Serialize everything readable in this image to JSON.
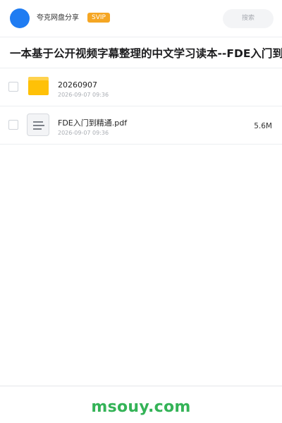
{
  "header": {
    "user_name": "夸克网盘分享",
    "badge": "SVIP",
    "search_placeholder": "搜索"
  },
  "folder": {
    "title": "一本基于公开视频字幕整理的中文学习读本--FDE入门到精通"
  },
  "files": [
    {
      "type": "folder",
      "icon": "folder-icon",
      "name": "20260907",
      "date": "2026-09-07 09:36",
      "size": ""
    },
    {
      "type": "file",
      "icon": "document-icon",
      "name": "FDE入门到精通.pdf",
      "date": "2026-09-07 09:36",
      "size": "5.6M"
    }
  ],
  "footer": {
    "brand": "msouy.com"
  },
  "colors": {
    "avatar": "#1f7cf2",
    "badge": "#f5a623",
    "folder": "#ffc107",
    "brand": "#34b357"
  }
}
